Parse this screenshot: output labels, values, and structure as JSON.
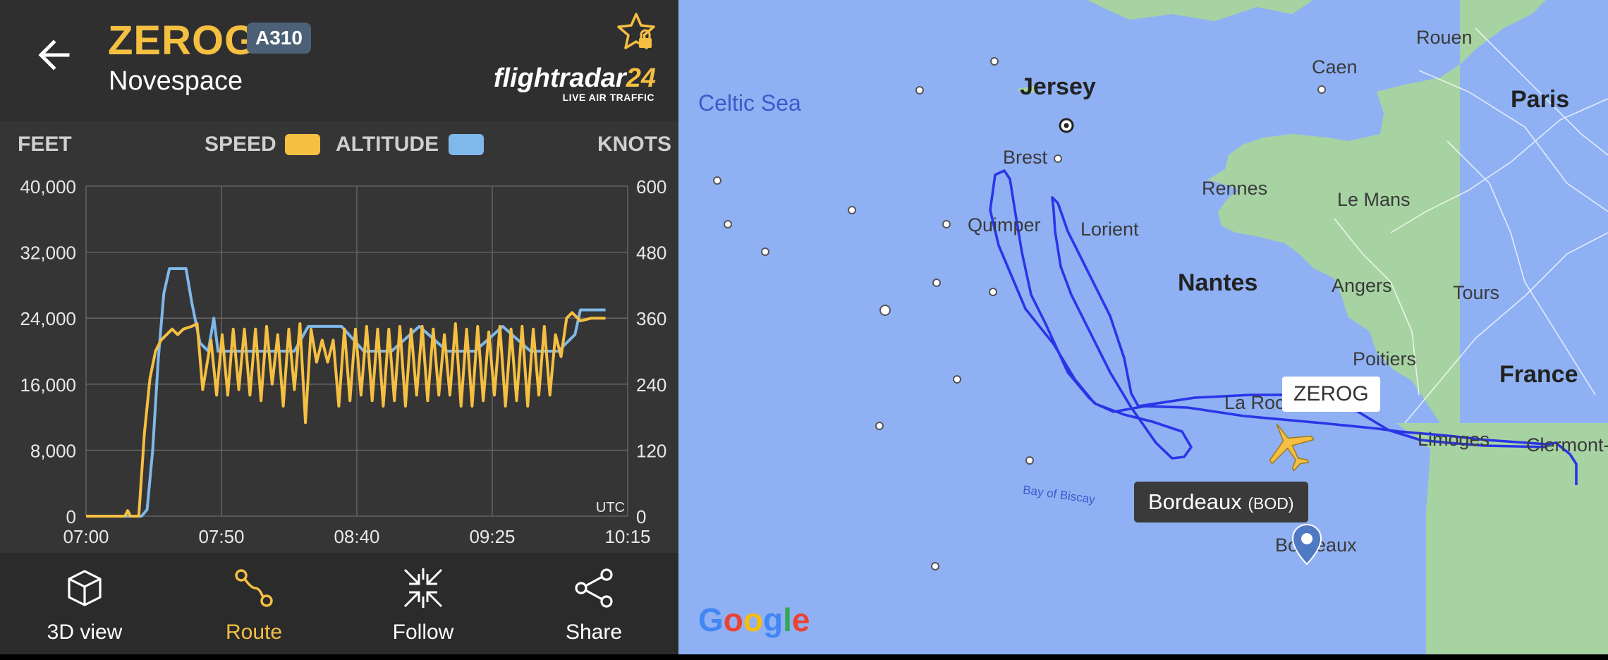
{
  "header": {
    "callsign": "ZEROG",
    "aircraft_type": "A310",
    "airline": "Novespace",
    "logo_main": "flightradar",
    "logo_num": "24",
    "logo_sub": "LIVE AIR TRAFFIC"
  },
  "chart_labels": {
    "left_unit": "FEET",
    "right_unit": "KNOTS",
    "speed": "SPEED",
    "altitude": "ALTITUDE",
    "tz": "UTC"
  },
  "chart_data": {
    "type": "line",
    "x_ticks": [
      "07:00",
      "07:50",
      "08:40",
      "09:25",
      "10:15"
    ],
    "y_left_ticks": [
      "0",
      "8,000",
      "16,000",
      "24,000",
      "32,000",
      "40,000"
    ],
    "y_right_ticks": [
      "0",
      "120",
      "240",
      "360",
      "480",
      "600"
    ],
    "ylim_left": [
      0,
      40000
    ],
    "ylim_right": [
      0,
      600
    ],
    "x_range_minutes": [
      0,
      195
    ],
    "series": [
      {
        "name": "ALTITUDE",
        "axis": "left",
        "color": "#7fb8ea",
        "x": [
          0,
          20,
          22,
          24,
          26,
          28,
          30,
          32,
          34,
          36,
          38,
          41,
          44,
          46,
          47.5,
          49,
          50.5,
          52,
          60,
          75,
          80,
          92,
          100,
          110,
          120,
          130,
          140,
          150,
          160,
          170,
          176,
          178,
          180,
          186,
          187
        ],
        "y": [
          0,
          0,
          800,
          8000,
          19000,
          27000,
          30000,
          30000,
          30000,
          30000,
          26000,
          21000,
          20000,
          24000,
          20000,
          20000,
          20000,
          20000,
          20000,
          20000,
          23000,
          23000,
          20000,
          20000,
          23000,
          20000,
          20000,
          23000,
          20000,
          20000,
          22000,
          25000,
          25000,
          25000,
          25000
        ]
      },
      {
        "name": "SPEED",
        "axis": "right",
        "color": "#f5bf42",
        "x": [
          0,
          14,
          15,
          16,
          19,
          21,
          23,
          25,
          27,
          29,
          31,
          33,
          35,
          38,
          40,
          42,
          45,
          47,
          49,
          51,
          53,
          55,
          57,
          59,
          61,
          63,
          65,
          67,
          69,
          71,
          73,
          75,
          77,
          79,
          81,
          83,
          85,
          87,
          89,
          91,
          93,
          95,
          97,
          99,
          101,
          103,
          105,
          107,
          109,
          111,
          113,
          115,
          117,
          119,
          121,
          123,
          125,
          127,
          129,
          131,
          133,
          135,
          137,
          139,
          141,
          143,
          145,
          147,
          149,
          151,
          153,
          155,
          157,
          159,
          161,
          163,
          165,
          167,
          169,
          171,
          173,
          175,
          178,
          182,
          187
        ],
        "y": [
          0,
          0,
          10,
          0,
          0,
          150,
          250,
          300,
          320,
          330,
          340,
          330,
          340,
          345,
          350,
          230,
          320,
          220,
          330,
          220,
          340,
          230,
          340,
          220,
          340,
          210,
          345,
          240,
          330,
          200,
          340,
          230,
          350,
          170,
          340,
          280,
          320,
          280,
          320,
          200,
          340,
          210,
          340,
          220,
          345,
          210,
          340,
          200,
          340,
          210,
          345,
          200,
          340,
          220,
          345,
          210,
          340,
          220,
          330,
          220,
          350,
          200,
          340,
          200,
          345,
          210,
          335,
          220,
          345,
          200,
          340,
          210,
          345,
          200,
          340,
          220,
          345,
          220,
          330,
          290,
          360,
          370,
          355,
          360,
          360
        ]
      }
    ]
  },
  "toolbar": {
    "items": [
      {
        "label": "3D view",
        "icon": "cube-icon"
      },
      {
        "label": "Route",
        "icon": "route-icon",
        "active": true
      },
      {
        "label": "Follow",
        "icon": "follow-icon"
      },
      {
        "label": "Share",
        "icon": "share-icon"
      }
    ]
  },
  "map": {
    "sea_labels": {
      "celtic": "Celtic Sea",
      "biscay": "Bay of Biscay"
    },
    "places": {
      "jersey": "Jersey",
      "caen": "Caen",
      "rouen": "Rouen",
      "paris": "Paris",
      "brest": "Brest",
      "rennes": "Rennes",
      "lemans": "Le Mans",
      "quimper": "Quimper",
      "lorient": "Lorient",
      "nantes": "Nantes",
      "angers": "Angers",
      "tours": "Tours",
      "poitiers": "Poitiers",
      "france": "France",
      "larochelle": "La Roc",
      "limoges": "Limoges",
      "clermont": "Clermont-F",
      "bordeaux": "Bordeaux"
    },
    "aircraft_label": "ZEROG",
    "airport_tooltip": {
      "name": "Bordeaux",
      "code": "(BOD)"
    },
    "google": "Google"
  },
  "colors": {
    "accent": "#f5bf42",
    "altitude": "#7fb8ea",
    "badge": "#4c6178",
    "route": "#1f2fe6",
    "sea": "#8fb1f4",
    "land": "#a7d3a2"
  }
}
